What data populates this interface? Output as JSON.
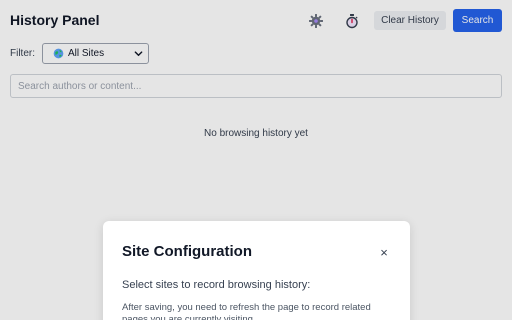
{
  "header": {
    "title": "History Panel",
    "settings_icon": "gear-icon",
    "timer_icon": "stopwatch-icon",
    "clear_label": "Clear History",
    "search_label": "Search"
  },
  "filter": {
    "label": "Filter:",
    "selected": "All Sites",
    "icon": "globe-icon"
  },
  "search": {
    "placeholder": "Search authors or content..."
  },
  "main": {
    "empty_message": "No browsing history yet"
  },
  "modal": {
    "title": "Site Configuration",
    "close": "×",
    "subtitle": "Select sites to record browsing history:",
    "note": "After saving, you need to refresh the page to record related pages you are currently visiting."
  },
  "colors": {
    "accent": "#2563eb",
    "overlay": "rgba(0,0,0,0.10)"
  }
}
